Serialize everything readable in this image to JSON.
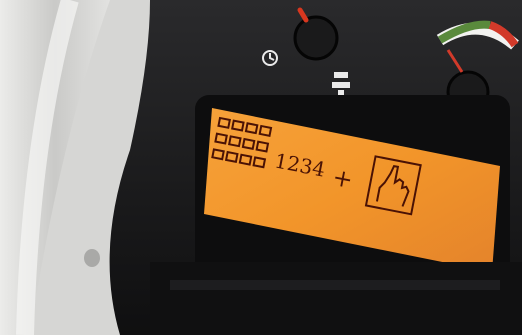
{
  "scene": {
    "description_colors": {
      "panel": "#1b1b1d",
      "lcd_background": "#f39a2c",
      "lcd_ink": "#4a1205",
      "gauge_green": "#5a8a3c",
      "gauge_red": "#d23a2a"
    }
  },
  "lcd": {
    "number": "1234",
    "plus": "+",
    "icon": "finger-touch-icon",
    "grid_rows": 3,
    "grid_cols": 4
  },
  "icons": {
    "left": "clock-icon",
    "middle": "tractor-icon",
    "right": "pto-icon"
  }
}
